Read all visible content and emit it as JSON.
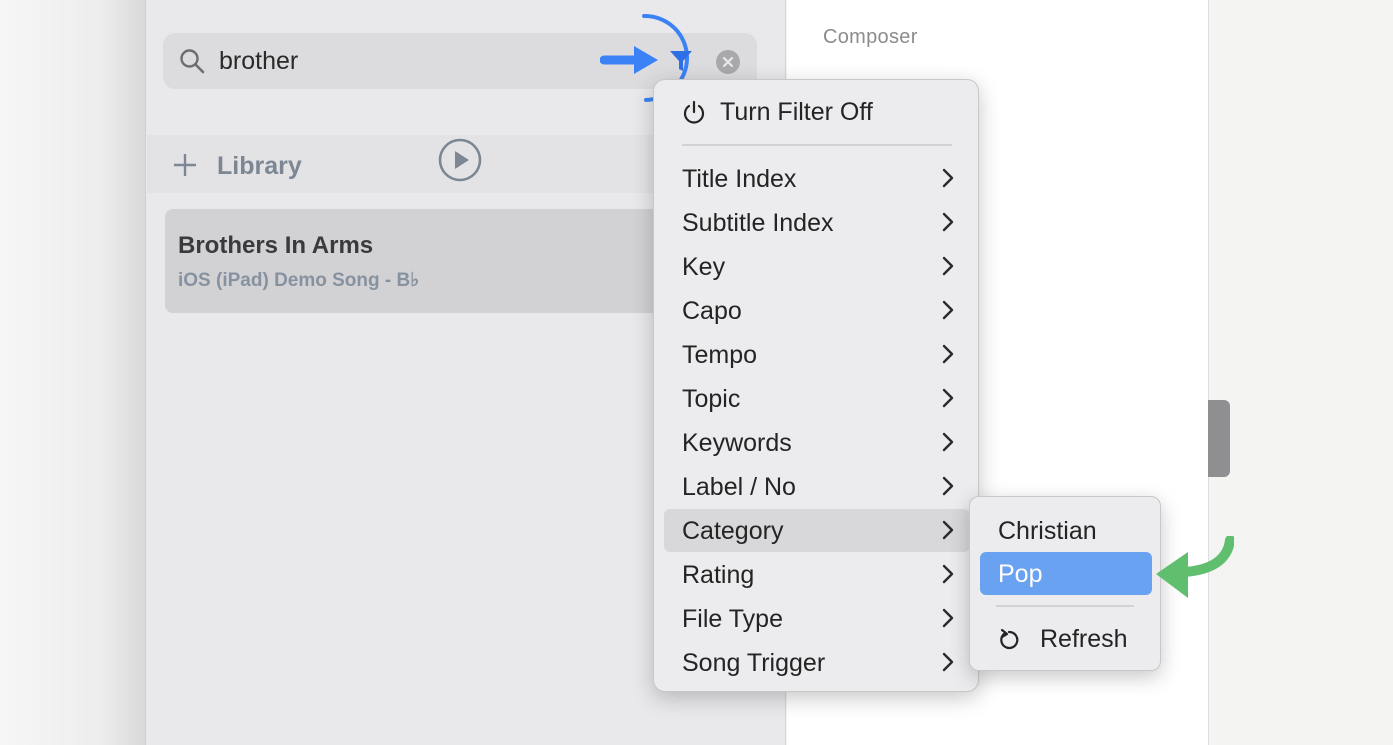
{
  "search": {
    "value": "brother",
    "icon": "search-icon",
    "filter_icon": "funnel-icon",
    "clear_icon": "clear-icon"
  },
  "library": {
    "label": "Library"
  },
  "song": {
    "title": "Brothers In Arms",
    "subtitle": "iOS (iPad) Demo Song - B♭"
  },
  "content": {
    "composer_label": "Composer"
  },
  "filter_menu": {
    "turn_off_label": "Turn Filter Off",
    "items": [
      {
        "label": "Title Index"
      },
      {
        "label": "Subtitle Index"
      },
      {
        "label": "Key"
      },
      {
        "label": "Capo"
      },
      {
        "label": "Tempo"
      },
      {
        "label": "Topic"
      },
      {
        "label": "Keywords"
      },
      {
        "label": "Label / No"
      },
      {
        "label": "Category"
      },
      {
        "label": "Rating"
      },
      {
        "label": "File Type"
      },
      {
        "label": "Song Trigger"
      }
    ],
    "highlighted": "Category"
  },
  "category_submenu": {
    "items": [
      {
        "label": "Christian"
      },
      {
        "label": "Pop"
      }
    ],
    "selected": "Pop",
    "refresh_label": "Refresh"
  },
  "colors": {
    "accent_blue": "#3b82f6",
    "selection_blue": "#6aa2f2",
    "annotation_green": "#5fbf6e"
  }
}
